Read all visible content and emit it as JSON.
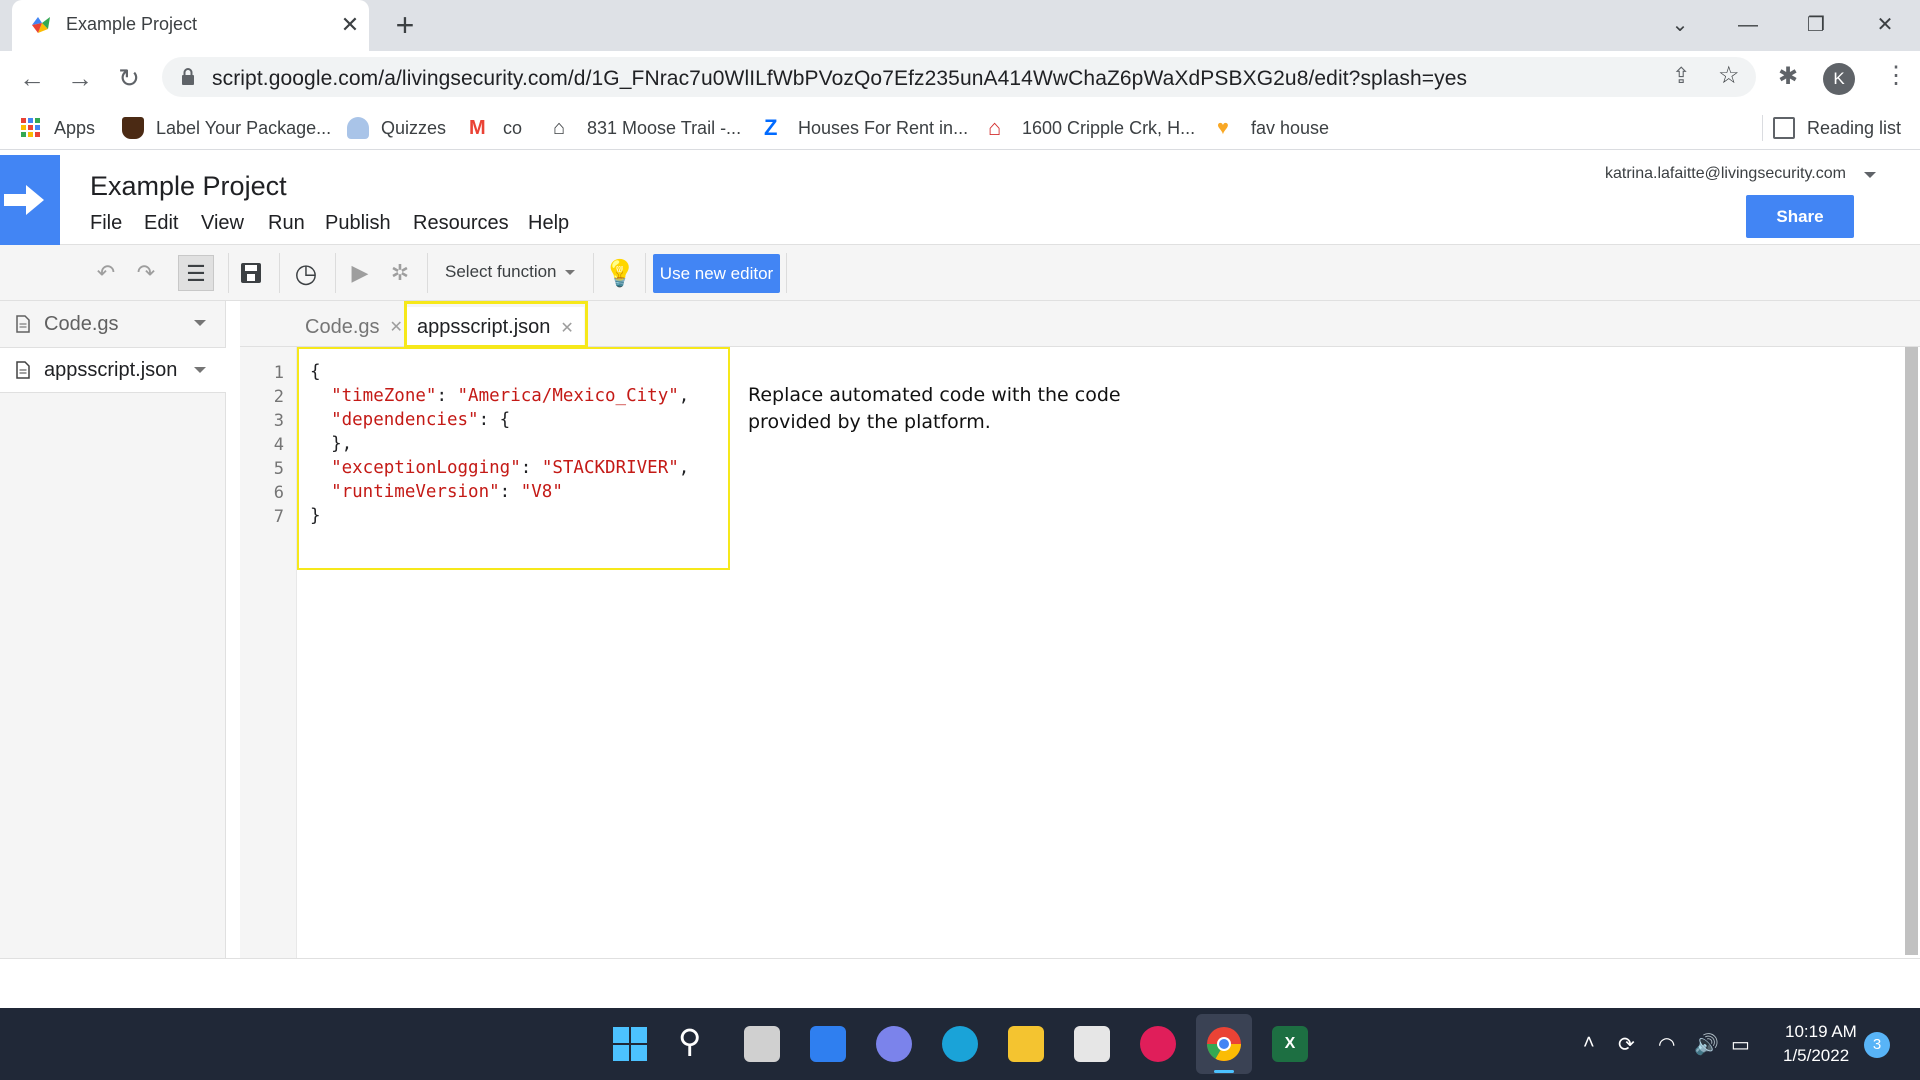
{
  "browser": {
    "tab_title": "Example Project",
    "tab_close": "✕",
    "new_tab": "+",
    "url": "script.google.com/a/livingsecurity.com/d/1G_FNrac7u0WlILfWbPVozQo7Efz235unA414WwChaZ6pWaXdPSBXG2u8/edit?splash=yes",
    "avatar_letter": "K",
    "window_controls": [
      "⌄",
      "—",
      "❐",
      "✕"
    ]
  },
  "bookmarks": [
    {
      "label": "Apps",
      "icon": "apps-grid-icon"
    },
    {
      "label": "Label Your Package...",
      "icon": "ups-icon"
    },
    {
      "label": "Quizzes",
      "icon": "person-icon"
    },
    {
      "label": "co",
      "icon": "gmail-icon"
    },
    {
      "label": "831 Moose Trail -...",
      "icon": "house-icon"
    },
    {
      "label": "Houses For Rent in...",
      "icon": "zillow-icon"
    },
    {
      "label": "1600 Cripple Crk, H...",
      "icon": "house-red-icon"
    },
    {
      "label": "fav house",
      "icon": "fav-icon"
    }
  ],
  "reading_list": "Reading list",
  "project": {
    "title": "Example Project",
    "user_email": "katrina.lafaitte@livingsecurity.com",
    "share_label": "Share",
    "menu": [
      "File",
      "Edit",
      "View",
      "Run",
      "Publish",
      "Resources",
      "Help"
    ]
  },
  "toolbar": {
    "select_function": "Select function",
    "use_new_editor": "Use new editor"
  },
  "files": [
    "Code.gs",
    "appsscript.json"
  ],
  "editor_tabs": [
    "Code.gs",
    "appsscript.json"
  ],
  "active_tab": "appsscript.json",
  "code_lines": [
    "1",
    "2",
    "3",
    "4",
    "5",
    "6",
    "7"
  ],
  "code": {
    "l1": "{",
    "l2_key": "\"timeZone\"",
    "l2_val": "\"America/Mexico_City\"",
    "l3_key": "\"dependencies\"",
    "l4": "},",
    "l5_key": "\"exceptionLogging\"",
    "l5_val": "\"STACKDRIVER\"",
    "l6_key": "\"runtimeVersion\"",
    "l6_val": "\"V8\"",
    "l7": "}"
  },
  "note": "Replace automated code with the code provided by the platform.",
  "taskbar": {
    "time": "10:19 AM",
    "date": "1/5/2022",
    "notifications": "3"
  },
  "colors": {
    "accent": "#4285f4",
    "highlight": "#f6e81a",
    "string": "#c41a16",
    "taskbar": "#202837"
  }
}
